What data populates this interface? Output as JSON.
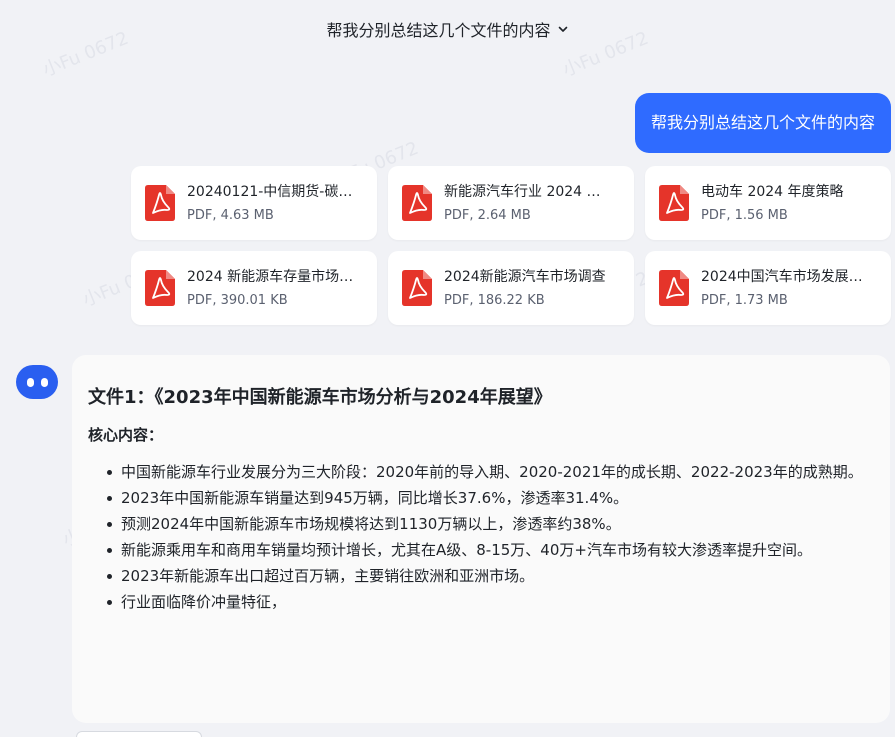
{
  "header": {
    "title": "帮我分别总结这几个文件的内容"
  },
  "user_message": {
    "text": "帮我分别总结这几个文件的内容"
  },
  "files": [
    {
      "name": "20240121-中信期货-碳…",
      "size": "PDF, 4.63 MB"
    },
    {
      "name": "新能源汽车行业 2024 …",
      "size": "PDF, 2.64 MB"
    },
    {
      "name": "电动车 2024 年度策略",
      "size": "PDF, 1.56 MB"
    },
    {
      "name": "2024 新能源车存量市场…",
      "size": "PDF, 390.01 KB"
    },
    {
      "name": "2024新能源汽车市场调查",
      "size": "PDF, 186.22 KB"
    },
    {
      "name": "2024中国汽车市场发展…",
      "size": "PDF, 1.73 MB"
    }
  ],
  "answer": {
    "title": "文件1：《2023年中国新能源车市场分析与2024年展望》",
    "subtitle": "核心内容：",
    "bullets": [
      "中国新能源车行业发展分为三大阶段：2020年前的导入期、2020-2021年的成长期、2022-2023年的成熟期。",
      "2023年中国新能源车销量达到945万辆，同比增长37.6%，渗透率31.4%。",
      "预测2024年中国新能源车市场规模将达到1130万辆以上，渗透率约38%。",
      "新能源乘用车和商用车销量均预计增长，尤其在A级、8-15万、40万+汽车市场有较大渗透率提升空间。",
      "2023年新能源车出口超过百万辆，主要销往欧洲和亚洲市场。",
      "行业面临降价冲量特征，"
    ]
  },
  "watermark": "小Fu 0672",
  "colors": {
    "accent": "#2f6bff",
    "pdf_red": "#e5342a"
  },
  "icons": {
    "file": "pdf-icon",
    "assistant": "assistant-avatar-icon",
    "dropdown": "chevron-down-icon"
  }
}
